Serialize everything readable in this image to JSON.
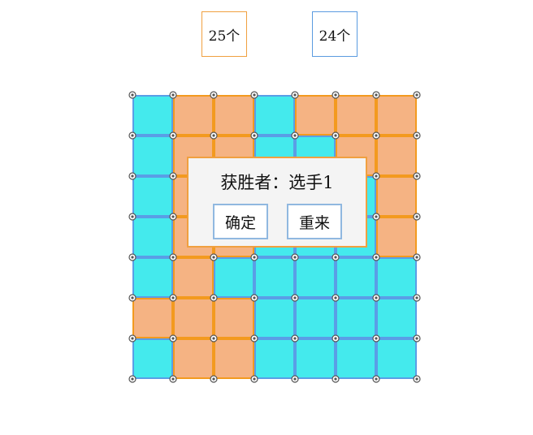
{
  "scores": {
    "player1": "25个",
    "player2": "24个"
  },
  "colors": {
    "player1_fill": "#f5b383",
    "player1_line": "#f39a1f",
    "player2_fill": "#44eaed",
    "player2_line": "#5a9ee6",
    "dot": "#555555"
  },
  "board": {
    "size": 7,
    "cells": [
      [
        "B",
        "O",
        "O",
        "B",
        "O",
        "O",
        "O"
      ],
      [
        "B",
        "O",
        "O",
        "B",
        "B",
        "O",
        "O"
      ],
      [
        "B",
        "O",
        "O",
        "B",
        "B",
        "B",
        "O"
      ],
      [
        "B",
        "O",
        "O",
        "B",
        "B",
        "B",
        "O"
      ],
      [
        "B",
        "O",
        "B",
        "B",
        "B",
        "B",
        "B"
      ],
      [
        "O",
        "O",
        "O",
        "B",
        "B",
        "B",
        "B"
      ],
      [
        "B",
        "O",
        "O",
        "B",
        "B",
        "B",
        "B"
      ]
    ]
  },
  "dialog": {
    "message": "获胜者：选手1",
    "confirm_label": "确定",
    "restart_label": "重来"
  }
}
